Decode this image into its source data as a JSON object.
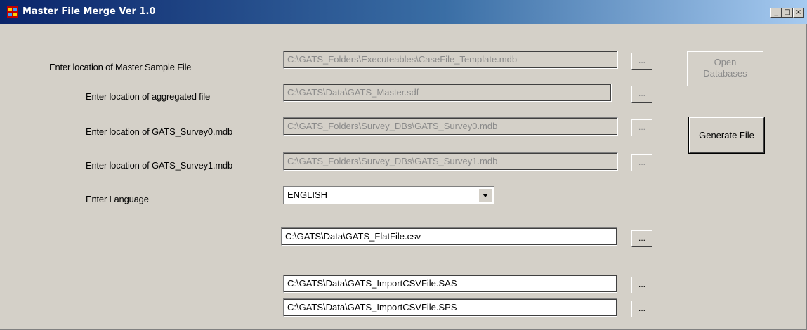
{
  "window": {
    "title": "Master File Merge   Ver 1.0",
    "controls": {
      "minimize": "_",
      "maximize": "□",
      "close": "×"
    }
  },
  "form": {
    "master_label": "Enter location of Master Sample File",
    "master_path": "C:\\GATS_Folders\\Executeables\\CaseFile_Template.mdb",
    "aggregated_label": "Enter location of aggregated file",
    "aggregated_path": "C:\\GATS\\Data\\GATS_Master.sdf",
    "survey0_label": "Enter location of GATS_Survey0.mdb",
    "survey0_path": "C:\\GATS_Folders\\Survey_DBs\\GATS_Survey0.mdb",
    "survey1_label": "Enter location of GATS_Survey1.mdb",
    "survey1_path": "C:\\GATS_Folders\\Survey_DBs\\GATS_Survey1.mdb",
    "language_label": "Enter Language",
    "language_value": "ENGLISH",
    "flatfile_path": "C:\\GATS\\Data\\GATS_FlatFile.csv",
    "sas_path": "C:\\GATS\\Data\\GATS_ImportCSVFile.SAS",
    "sps_path": "C:\\GATS\\Data\\GATS_ImportCSVFile.SPS",
    "browse_label": "...",
    "open_db_line1": "Open",
    "open_db_line2": "Databases",
    "generate_label": "Generate File"
  }
}
